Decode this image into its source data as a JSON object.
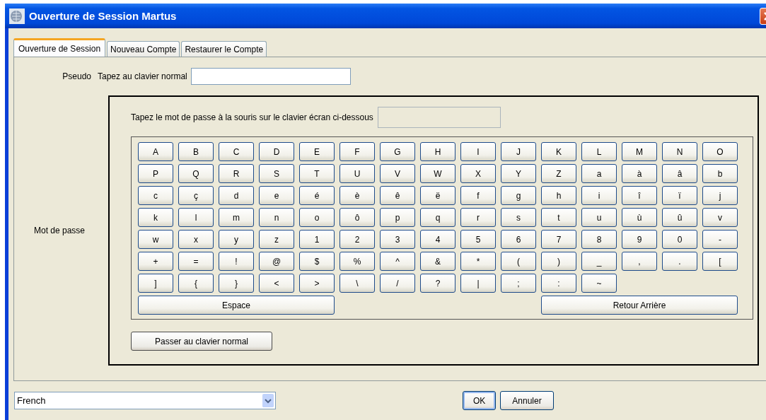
{
  "window": {
    "title": "Ouverture de Session Martus"
  },
  "tabs": [
    {
      "label": "Ouverture de Session",
      "selected": true
    },
    {
      "label": "Nouveau Compte",
      "selected": false
    },
    {
      "label": "Restaurer le Compte",
      "selected": false
    }
  ],
  "username": {
    "label": "Pseudo",
    "hint": "Tapez au clavier normal"
  },
  "password": {
    "label": "Mot de passe",
    "instruction": "Tapez le mot de passe à la souris sur le clavier écran ci-dessous",
    "key_rows": [
      [
        "A",
        "B",
        "C",
        "D",
        "E",
        "F",
        "G",
        "H",
        "I",
        "J",
        "K",
        "L",
        "M",
        "N",
        "O"
      ],
      [
        "P",
        "Q",
        "R",
        "S",
        "T",
        "U",
        "V",
        "W",
        "X",
        "Y",
        "Z",
        "a",
        "à",
        "â",
        "b"
      ],
      [
        "c",
        "ç",
        "d",
        "e",
        "é",
        "è",
        "ê",
        "ë",
        "f",
        "g",
        "h",
        "i",
        "î",
        "ï",
        "j"
      ],
      [
        "k",
        "l",
        "m",
        "n",
        "o",
        "ô",
        "p",
        "q",
        "r",
        "s",
        "t",
        "u",
        "ù",
        "û",
        "v"
      ],
      [
        "w",
        "x",
        "y",
        "z",
        "1",
        "2",
        "3",
        "4",
        "5",
        "6",
        "7",
        "8",
        "9",
        "0",
        "-"
      ],
      [
        "+",
        "=",
        "!",
        "@",
        "$",
        "%",
        "^",
        "&",
        "*",
        "(",
        ")",
        "_",
        ",",
        ".",
        "["
      ],
      [
        "]",
        "{",
        "}",
        "<",
        ">",
        "\\",
        "/",
        "?",
        "|",
        ";",
        ":",
        "~"
      ]
    ],
    "space_key": "Espace",
    "backspace_key": "Retour Arrière",
    "switch_button": "Passer au clavier normal"
  },
  "footer": {
    "language": "French",
    "buttons": [
      "OK",
      "Annuler"
    ]
  }
}
